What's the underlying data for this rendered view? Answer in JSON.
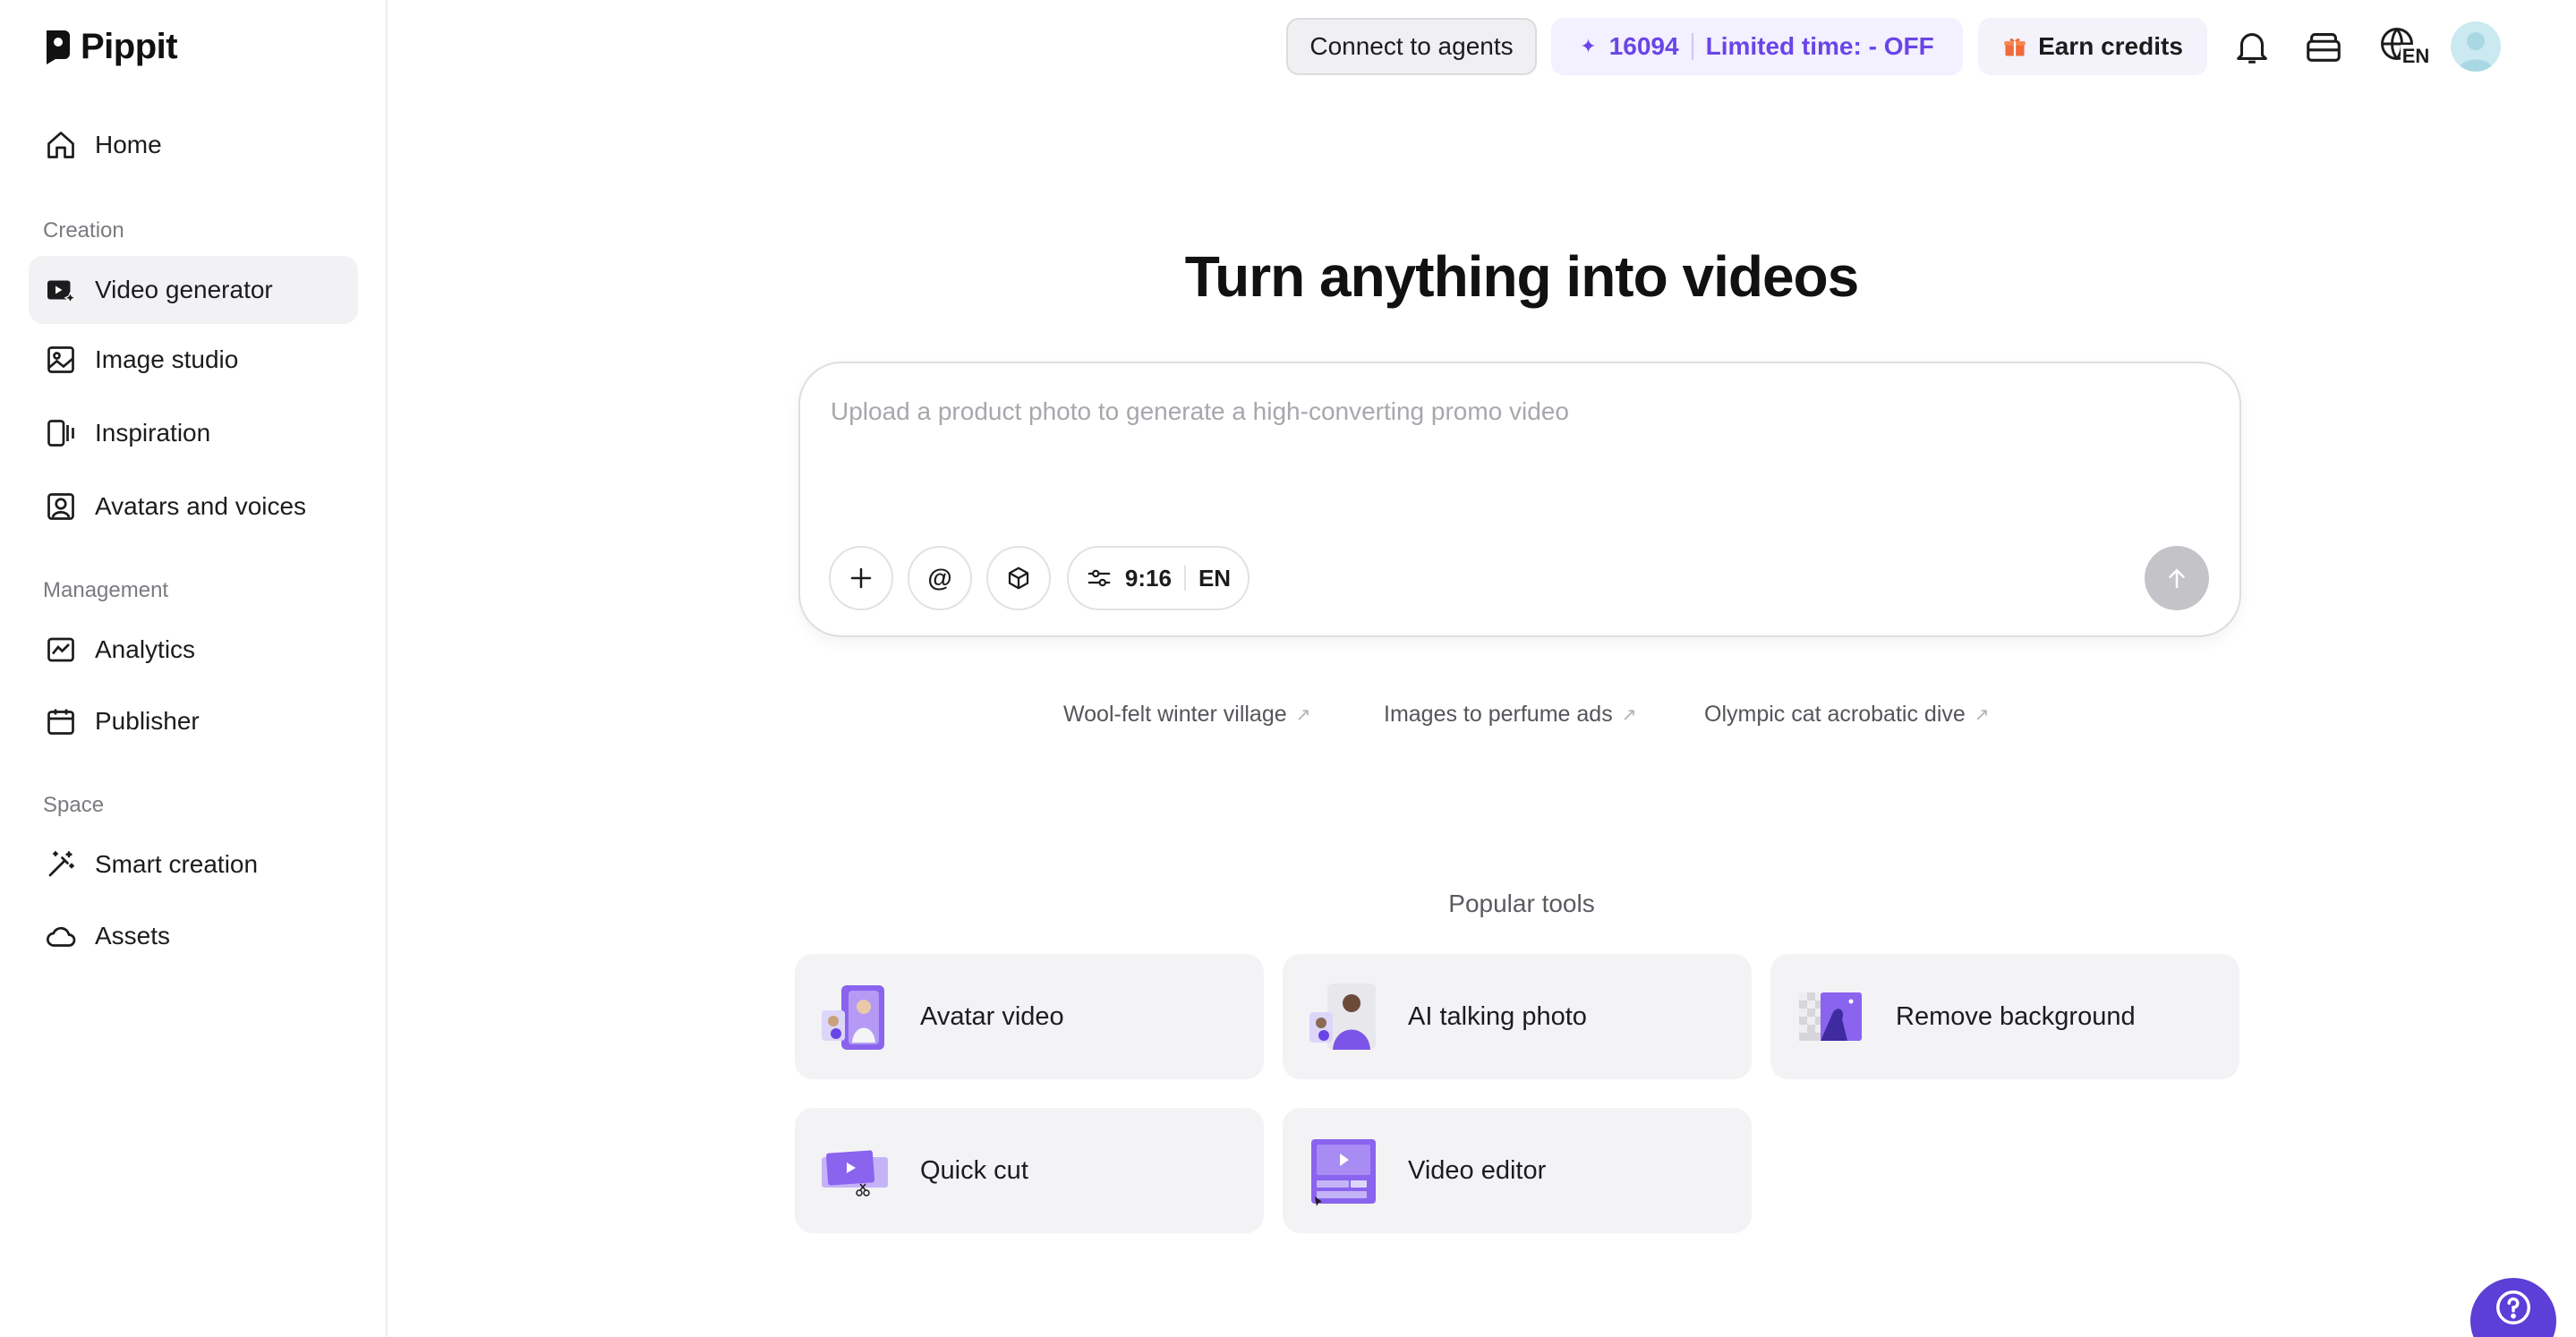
{
  "brand": {
    "name": "Pippit"
  },
  "sidebar": {
    "home": "Home",
    "sections": {
      "creation": "Creation",
      "management": "Management",
      "space": "Space"
    },
    "items": {
      "video_generator": "Video generator",
      "image_studio": "Image studio",
      "inspiration": "Inspiration",
      "avatars_voices": "Avatars and voices",
      "analytics": "Analytics",
      "publisher": "Publisher",
      "smart_creation": "Smart creation",
      "assets": "Assets"
    },
    "active": "video_generator"
  },
  "topbar": {
    "connect_label": "Connect to agents",
    "credits_count": "16094",
    "credits_promo": "Limited time: - OFF",
    "earn_label": "Earn credits",
    "language": "EN"
  },
  "main": {
    "title": "Turn anything into videos",
    "prompt_placeholder": "Upload a product photo to generate a high-converting promo video",
    "aspect_ratio": "9:16",
    "language": "EN",
    "suggestions": [
      "Wool-felt winter village",
      "Images to perfume ads",
      "Olympic cat acrobatic dive"
    ],
    "popular_label": "Popular tools",
    "tools": [
      "Avatar video",
      "AI talking photo",
      "Remove background",
      "Quick cut",
      "Video editor"
    ]
  },
  "colors": {
    "accent": "#6a45e6",
    "credits_bg": "#f3f0ff",
    "help_button": "#5b3fd6",
    "active_nav": "#f2f2f4"
  },
  "icons": {
    "home": "home-icon",
    "video_generator": "video-generator-icon",
    "image_studio": "image-icon",
    "inspiration": "inspiration-icon",
    "avatars_voices": "avatar-icon",
    "analytics": "chart-icon",
    "publisher": "calendar-icon",
    "smart_creation": "magic-wand-icon",
    "assets": "cloud-icon",
    "notification": "bell-icon",
    "wallet": "wallet-icon",
    "language": "globe-icon",
    "help": "question-icon"
  }
}
